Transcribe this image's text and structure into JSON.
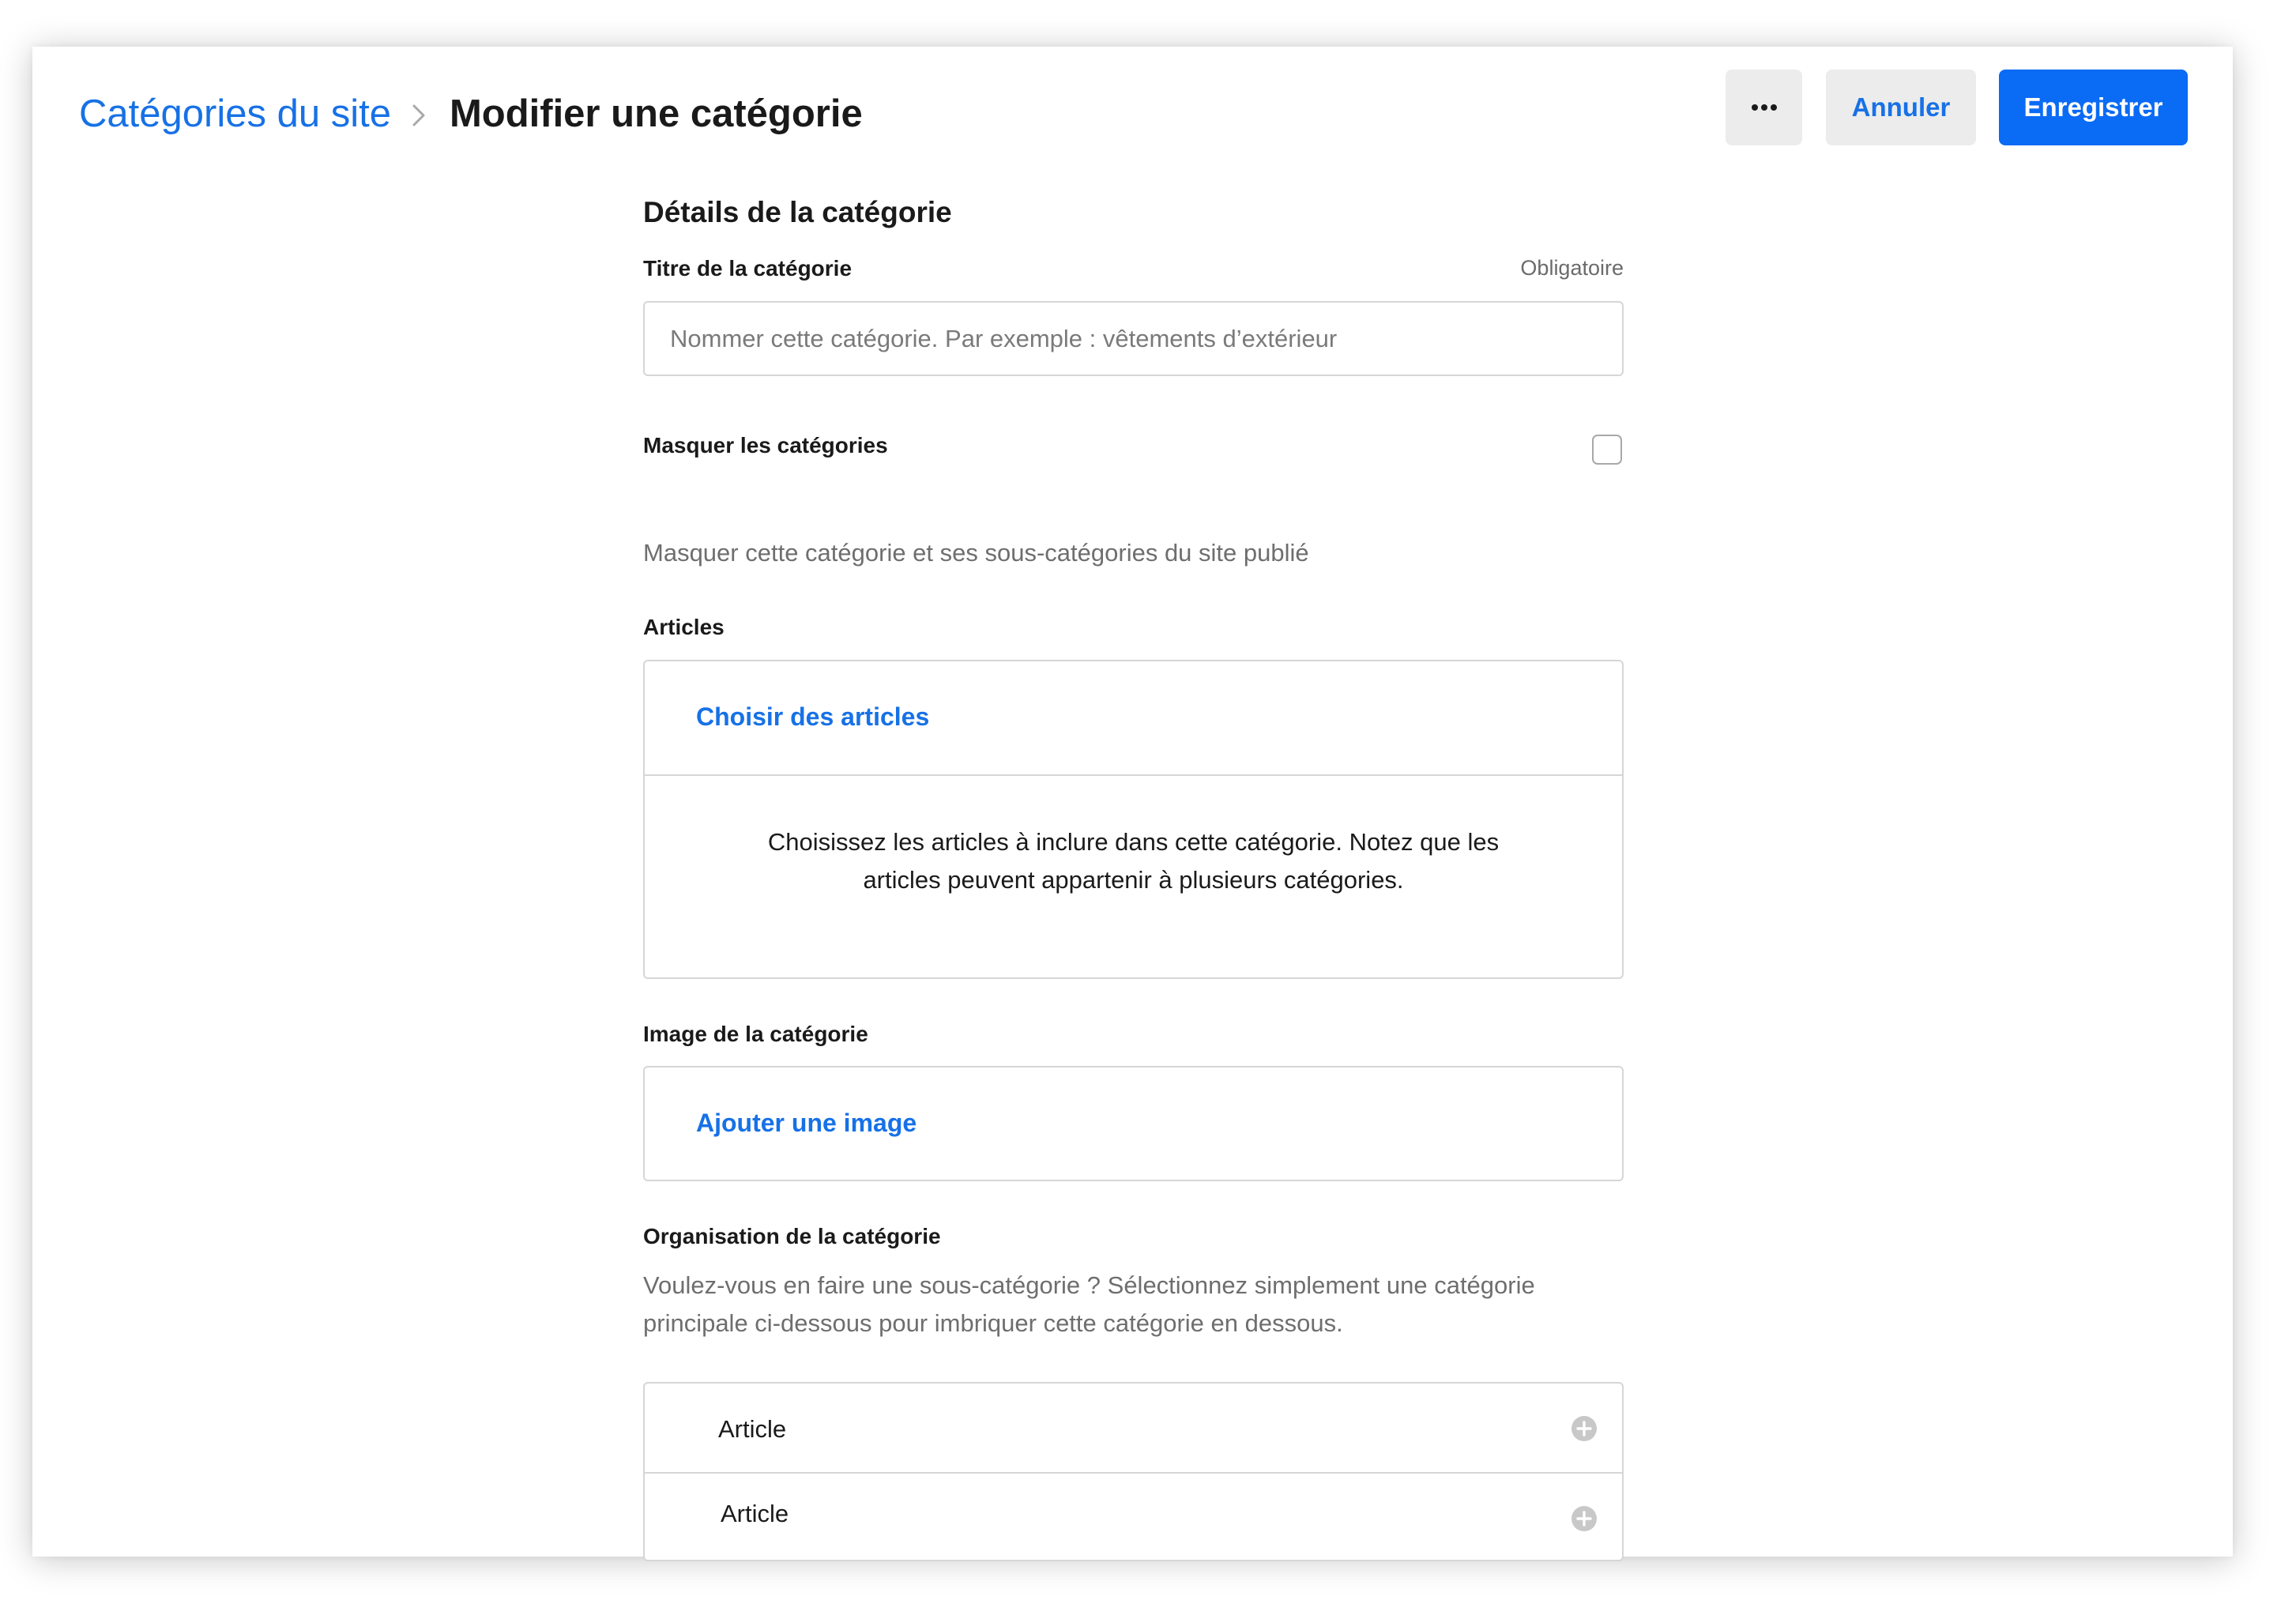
{
  "header": {
    "breadcrumb_parent": "Catégories du site",
    "breadcrumb_current": "Modifier une catégorie",
    "more_label": "•••",
    "cancel_label": "Annuler",
    "save_label": "Enregistrer"
  },
  "form": {
    "section_title": "Détails de la catégorie",
    "title_field": {
      "label": "Titre de la catégorie",
      "required_text": "Obligatoire",
      "value": "",
      "placeholder": "Nommer cette catégorie. Par exemple : vêtements d’extérieur"
    },
    "hide": {
      "label": "Masquer les catégories",
      "checked": false,
      "helper": "Masquer cette catégorie et ses sous-catégories du site publié"
    },
    "articles": {
      "label": "Articles",
      "choose_link": "Choisir des articles",
      "description": "Choisissez les articles à inclure dans cette catégorie. Notez que les articles peuvent appartenir à plusieurs catégories."
    },
    "image": {
      "label": "Image de la catégorie",
      "add_link": "Ajouter une image"
    },
    "organisation": {
      "label": "Organisation de la catégorie",
      "helper": "Voulez-vous en faire une sous-catégorie ? Sélectionnez simplement une catégorie principale ci-dessous pour imbriquer cette catégorie en dessous.",
      "rows": [
        {
          "label": "Article",
          "icon": "plus-circle-icon"
        },
        {
          "label": "Article",
          "icon": "plus-circle-icon"
        }
      ]
    }
  },
  "colors": {
    "accent": "#1771e6",
    "primary_button": "#0a6bf5",
    "secondary_button": "#ececec",
    "border": "#d6d6d6",
    "text": "#1a1a1a",
    "muted_text": "#6e6e6e"
  }
}
